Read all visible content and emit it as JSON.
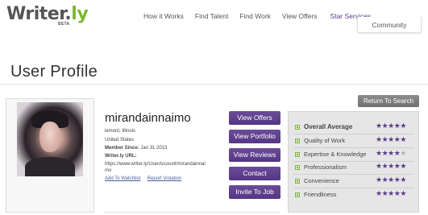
{
  "logo": {
    "text_main": "Writer.",
    "text_accent": "ly",
    "badge": "BETA"
  },
  "nav": {
    "items": [
      {
        "label": "How it Works"
      },
      {
        "label": "Find Talent"
      },
      {
        "label": "Find Work"
      },
      {
        "label": "View Offers"
      },
      {
        "label": "Star Services"
      }
    ],
    "community": "Community"
  },
  "page": {
    "title": "User Profile"
  },
  "return_button": "Return To Search",
  "profile": {
    "username": "mirandainnaimo",
    "city": "lemont,   Illinois",
    "country": "United States",
    "member_since_label": "Member Since:",
    "member_since_value": "Jan 31 2013",
    "url_label": "Writer.ly URL:",
    "url_line1": "https://www.writer.ly/UserAccount/mirandainnai",
    "url_line2": "mo",
    "add_watchlist": "Add To Watchlist",
    "report_violation": "Report Violation"
  },
  "actions": [
    {
      "label": "View Offers"
    },
    {
      "label": "View Portfolio"
    },
    {
      "label": "View Reviews"
    },
    {
      "label": "Contact"
    },
    {
      "label": "Invite To Job"
    }
  ],
  "ratings": [
    {
      "label": "Overall Average",
      "stars": 5,
      "bold": true
    },
    {
      "label": "Quality of Work",
      "stars": 5
    },
    {
      "label": "Expertise & Knowledge",
      "stars": 4
    },
    {
      "label": "Professionalism",
      "stars": 5
    },
    {
      "label": "Convenience",
      "stars": 5
    },
    {
      "label": "Friendliness",
      "stars": 5
    }
  ],
  "colors": {
    "brand_green": "#7cb82f",
    "button_purple": "#5f4190",
    "star_purple": "#5a3d8a"
  }
}
